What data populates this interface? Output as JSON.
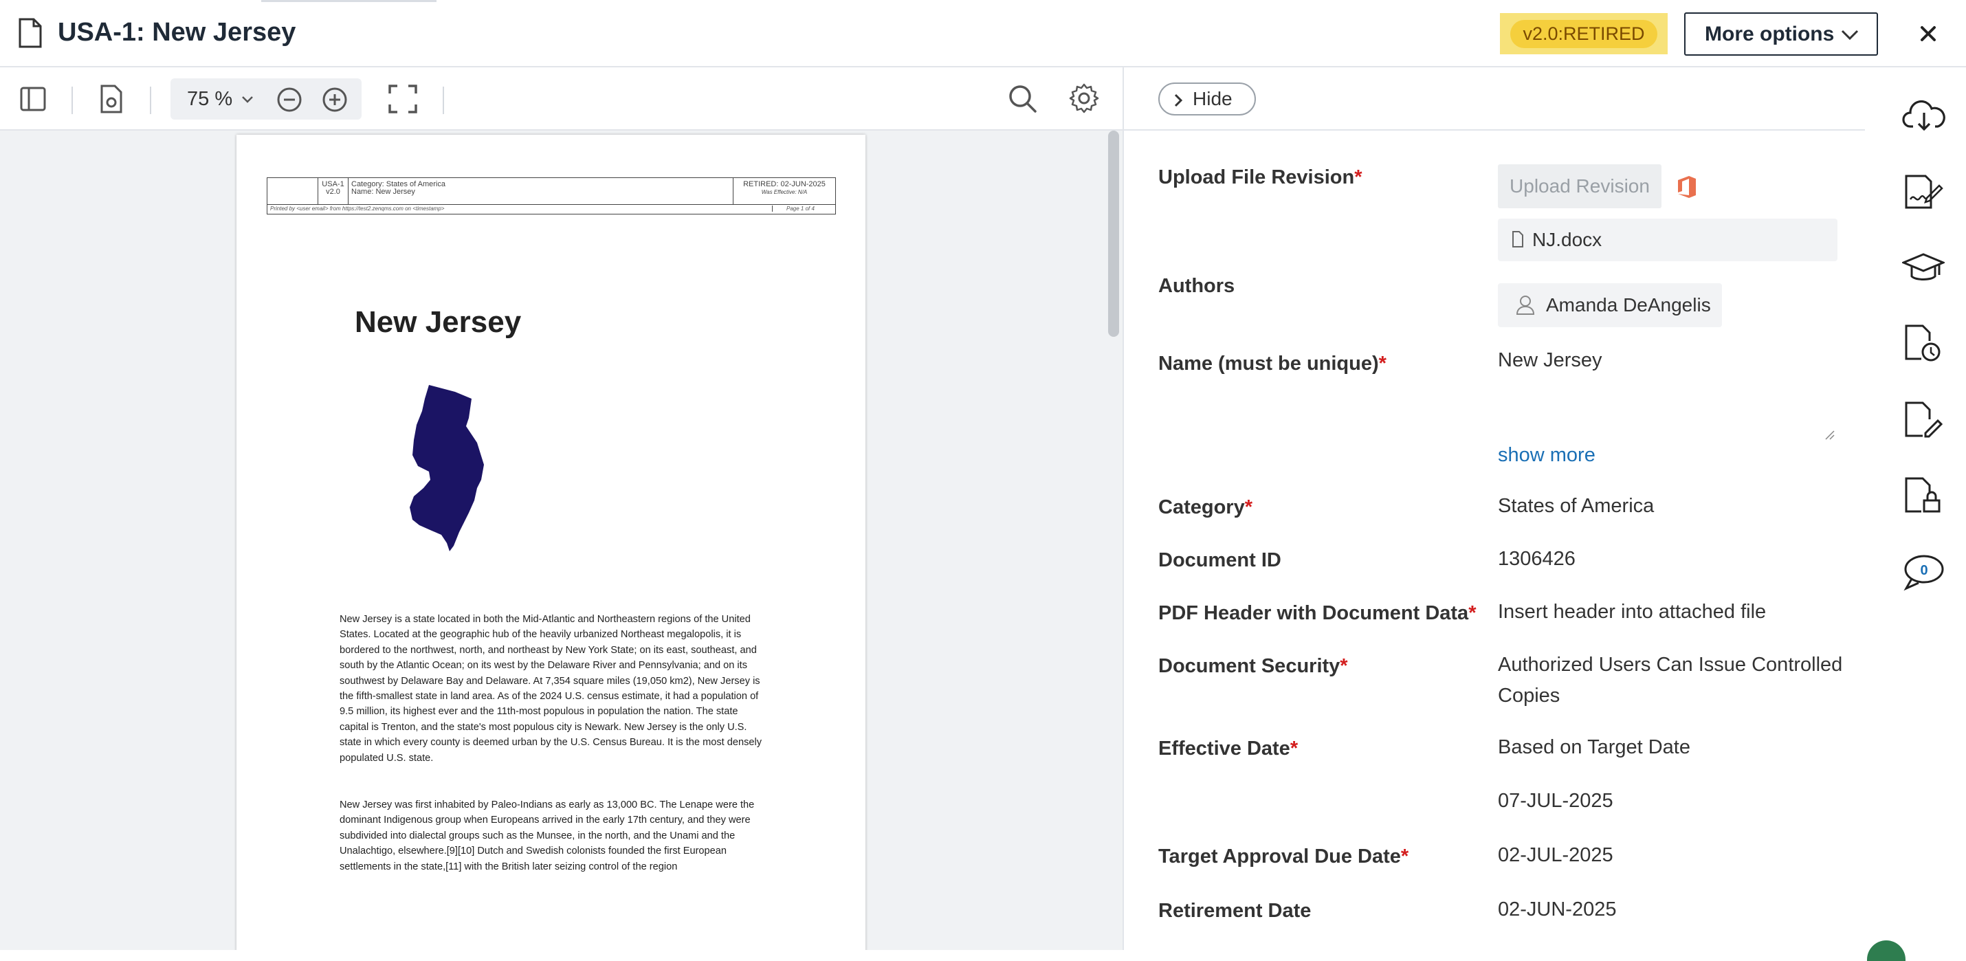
{
  "header": {
    "title": "USA-1: New Jersey",
    "status_badge": "v2.0:RETIRED",
    "more_options_label": "More options"
  },
  "viewer": {
    "zoom": "75 %",
    "page": {
      "header_table": {
        "doc_number": "USA-1",
        "version": "v2.0",
        "category_label": "Category:",
        "category_value": "States of America",
        "name_label": "Name:",
        "name_value": "New Jersey",
        "status": "RETIRED: 02-JUN-2025",
        "was_effective": "Was Effective: N/A",
        "printed_by": "Printed by <user email> from https://test2.zenqms.com on <timestamp>",
        "page_of": "Page 1 of 4"
      },
      "title": "New Jersey",
      "paragraphs": [
        "New Jersey is a state located in both the Mid-Atlantic and Northeastern regions of the United States. Located at the geographic hub of the heavily urbanized Northeast megalopolis, it is bordered to the northwest, north, and northeast by New York State; on its east, southeast, and south by the Atlantic Ocean; on its west by the Delaware River and Pennsylvania; and on its southwest by Delaware Bay and Delaware. At 7,354 square miles (19,050 km2), New Jersey is the fifth-smallest state in land area. As of the 2024 U.S. census estimate, it had a population of 9.5 million, its highest ever and the 11th-most populous in population the nation. The state capital is Trenton, and the state's most populous city is Newark. New Jersey is the only U.S. state in which every county is deemed urban by the U.S. Census Bureau. It is the most densely populated U.S. state.",
        "New Jersey was first inhabited by Paleo-Indians as early as 13,000 BC. The Lenape were the dominant Indigenous group when Europeans arrived in the early 17th century, and they were subdivided into dialectal groups such as the Munsee, in the north, and the Unami and the Unalachtigo, elsewhere.[9][10] Dutch and Swedish colonists founded the first European settlements in the state,[11] with the British later seizing control of the region"
      ]
    }
  },
  "panel": {
    "hide_label": "Hide",
    "fields": {
      "upload": {
        "label": "Upload File Revision",
        "required": "*",
        "button": "Upload Revision",
        "file_name": "NJ.docx"
      },
      "authors": {
        "label": "Authors",
        "value": "Amanda DeAngelis"
      },
      "name": {
        "label": "Name (must be unique)",
        "required": "*",
        "value": "New Jersey",
        "show_more": "show more"
      },
      "category": {
        "label": "Category",
        "required": "*",
        "value": "States of America"
      },
      "document_id": {
        "label": "Document ID",
        "value": "1306426"
      },
      "pdf_header": {
        "label": "PDF Header with Document Data",
        "required": "*",
        "value": "Insert header into attached file"
      },
      "security": {
        "label": "Document Security",
        "required": "*",
        "value": "Authorized Users Can Issue Controlled Copies"
      },
      "effective_date": {
        "label": "Effective Date",
        "required": "*",
        "value": "Based on Target Date",
        "date": "07-JUL-2025"
      },
      "target_due": {
        "label": "Target Approval Due Date",
        "required": "*",
        "value": "02-JUL-2025"
      },
      "retirement": {
        "label": "Retirement Date",
        "value": "02-JUN-2025"
      }
    }
  },
  "rail": {
    "icons": [
      "cloud-download-icon",
      "signature-icon",
      "training-icon",
      "document-history-icon",
      "document-edit-icon",
      "document-lock-icon",
      "comments-icon"
    ],
    "comment_count": "0"
  },
  "colors": {
    "badge_bg": "#f7e27a",
    "badge_pill": "#f5cf3d",
    "required": "#d31d1d",
    "link": "#1a6fb5",
    "map_fill": "#1b1464"
  }
}
